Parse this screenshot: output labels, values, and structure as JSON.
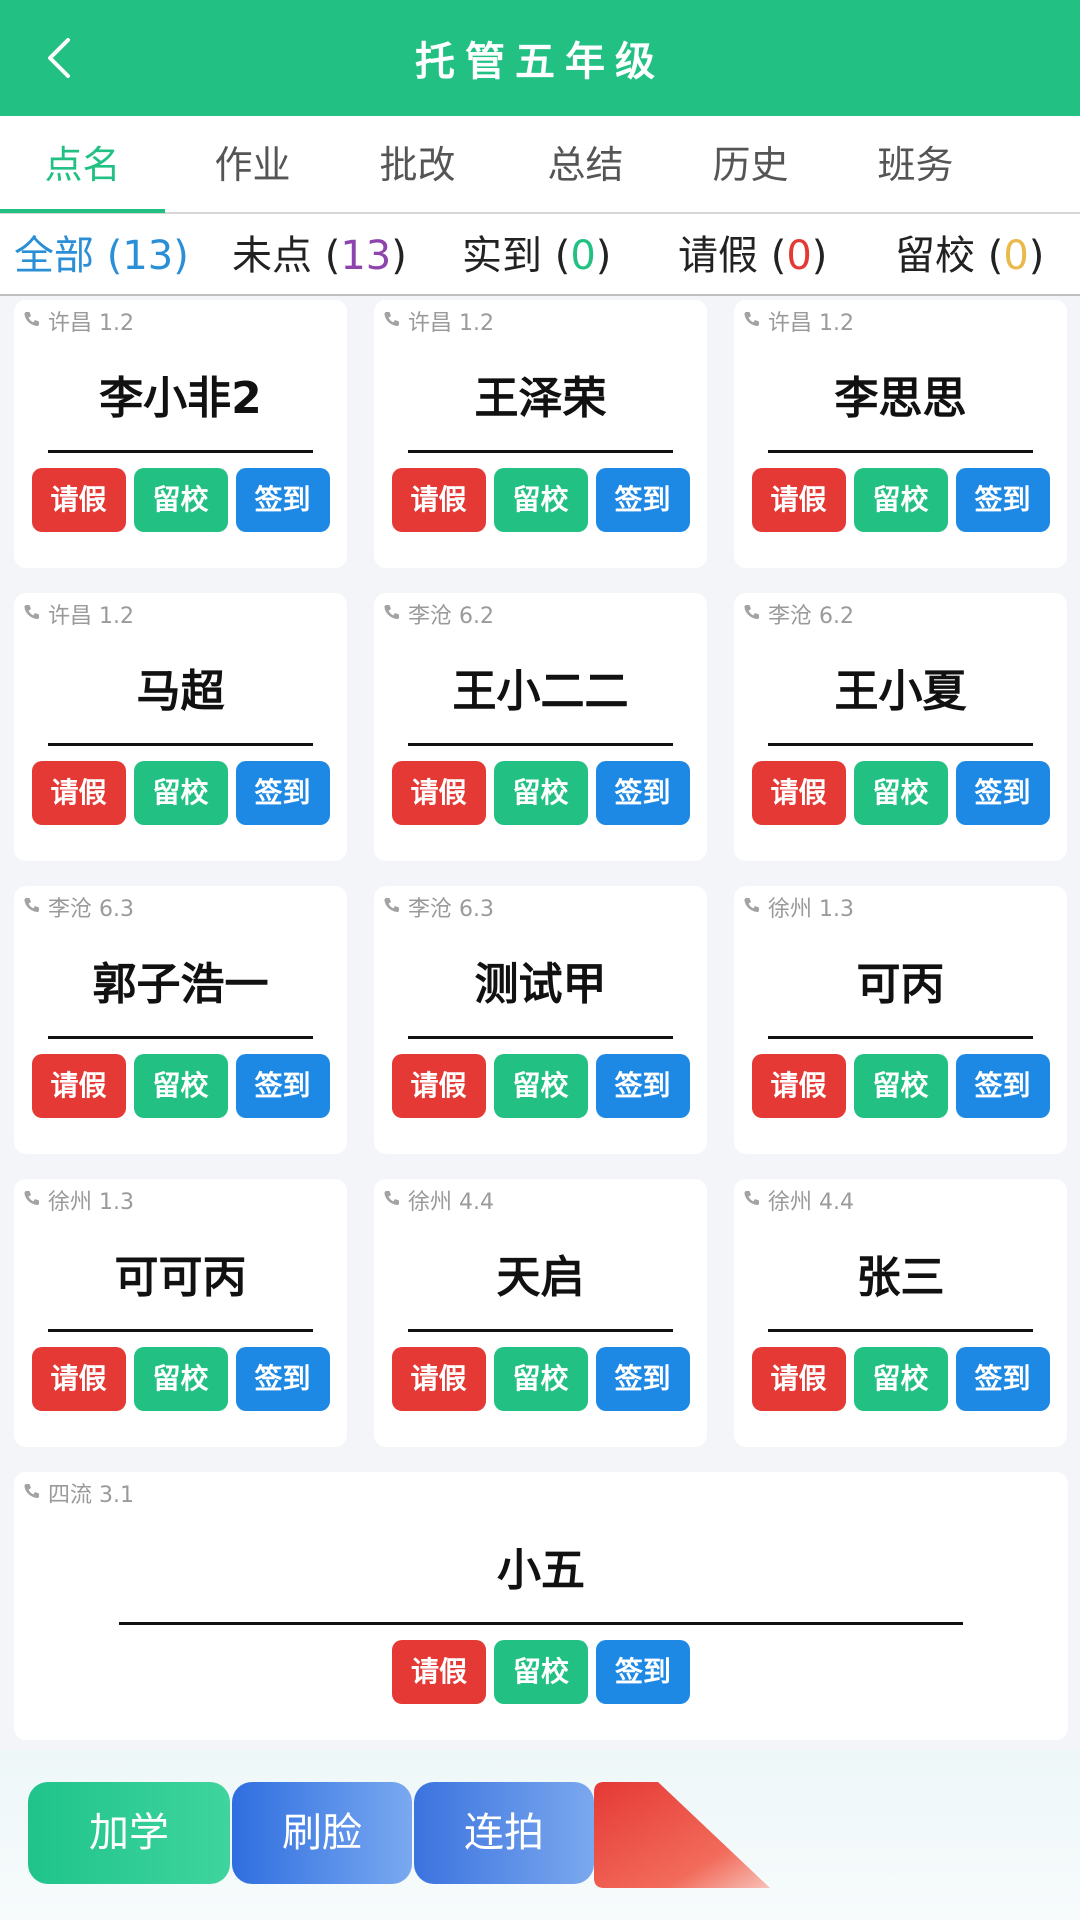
{
  "header": {
    "title": "托管五年级"
  },
  "tabs": [
    "点名",
    "作业",
    "批改",
    "总结",
    "历史",
    "班务"
  ],
  "filters": [
    {
      "label": "全部",
      "count": "13",
      "color": "#2a8fd6"
    },
    {
      "label": "未点",
      "count": "13",
      "color": "#8e44ad"
    },
    {
      "label": "实到",
      "count": "0",
      "color": "#22c183"
    },
    {
      "label": "请假",
      "count": "0",
      "color": "#e53935"
    },
    {
      "label": "留校",
      "count": "0",
      "color": "#e9b949"
    }
  ],
  "button_labels": {
    "leave": "请假",
    "stay": "留校",
    "sign": "签到"
  },
  "students": [
    {
      "location": "许昌 1.2",
      "name": "李小非2"
    },
    {
      "location": "许昌 1.2",
      "name": "王泽荣"
    },
    {
      "location": "许昌 1.2",
      "name": "李思思"
    },
    {
      "location": "许昌 1.2",
      "name": "马超"
    },
    {
      "location": "李沧 6.2",
      "name": "王小二二"
    },
    {
      "location": "李沧 6.2",
      "name": "王小夏"
    },
    {
      "location": "李沧 6.3",
      "name": "郭子浩一"
    },
    {
      "location": "李沧 6.3",
      "name": "测试甲"
    },
    {
      "location": "徐州 1.3",
      "name": "可丙"
    },
    {
      "location": "徐州 1.3",
      "name": "可可丙"
    },
    {
      "location": "徐州 4.4",
      "name": "天启"
    },
    {
      "location": "徐州 4.4",
      "name": "张三"
    },
    {
      "location": "四流 3.1",
      "name": "小五"
    }
  ],
  "bottom": {
    "add": "加学",
    "face": "刷脸",
    "burst": "连拍"
  },
  "colors": {
    "accent": "#22c183",
    "leave": "#e53935",
    "stay": "#22c183",
    "sign": "#1e88e5"
  }
}
